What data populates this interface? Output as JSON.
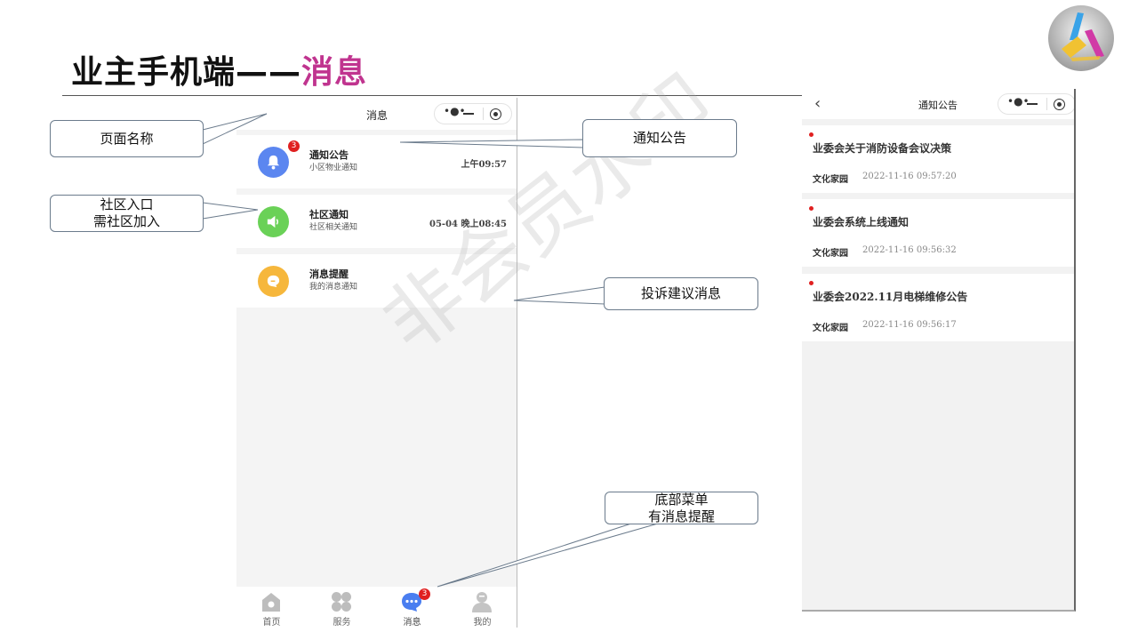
{
  "slide": {
    "title_main": "业主手机端——",
    "title_accent": "消息",
    "colors": {
      "accent": "#c0348f",
      "badge": "#e02020"
    }
  },
  "watermark": "非会员水印",
  "phone_messages": {
    "nav_title": "消息",
    "items": [
      {
        "title": "通知公告",
        "subtitle": "小区物业通知",
        "time": "上午09:57",
        "badge": "3",
        "icon": "bell-icon",
        "color": "#5b86f0"
      },
      {
        "title": "社区通知",
        "subtitle": "社区相关通知",
        "time": "05-04 晚上08:45",
        "icon": "speaker-icon",
        "color": "#6ad157"
      },
      {
        "title": "消息提醒",
        "subtitle": "我的消息通知",
        "time": "",
        "icon": "chat-bubble-icon",
        "color": "#f6b73c"
      }
    ],
    "tabbar": [
      {
        "label": "首页",
        "icon": "home-icon"
      },
      {
        "label": "服务",
        "icon": "grid-icon"
      },
      {
        "label": "消息",
        "icon": "message-icon",
        "badge": "3",
        "active": true
      },
      {
        "label": "我的",
        "icon": "user-icon"
      }
    ]
  },
  "phone_notices": {
    "nav_title": "通知公告",
    "items": [
      {
        "title": "业委会关于消防设备会议决策",
        "source": "文化家园",
        "time": "2022-11-16 09:57:20"
      },
      {
        "title": "业委会系统上线通知",
        "source": "文化家园",
        "time": "2022-11-16 09:56:32"
      },
      {
        "title": "业委会2022.11月电梯维修公告",
        "source": "文化家园",
        "time": "2022-11-16 09:56:17"
      }
    ]
  },
  "callouts": {
    "page_name": "页面名称",
    "community_line1": "社区入口",
    "community_line2": "需社区加入",
    "notice": "通知公告",
    "complaint": "投诉建议消息",
    "bottom_line1": "底部菜单",
    "bottom_line2": "有消息提醒"
  }
}
